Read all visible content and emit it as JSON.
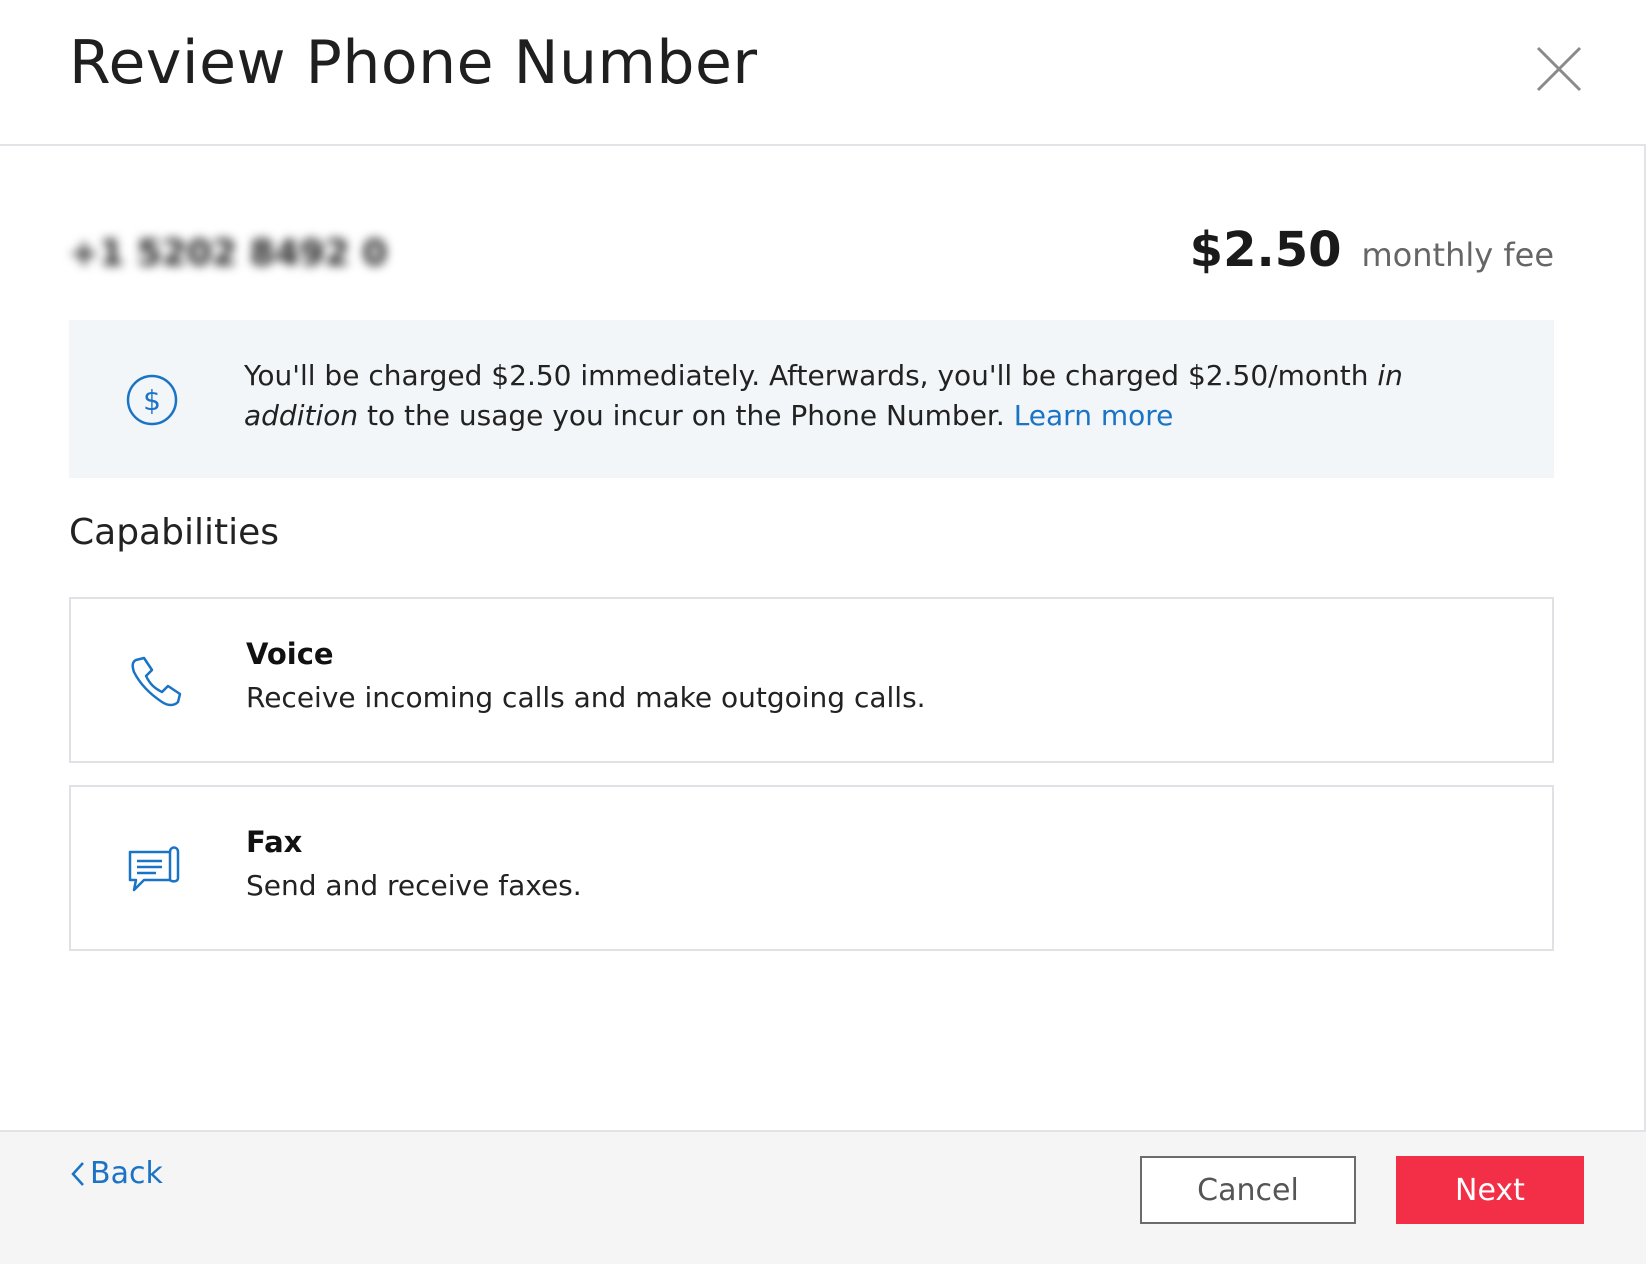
{
  "header": {
    "title": "Review Phone Number"
  },
  "number": {
    "phone": "+1 5202 8492 0",
    "fee_amount": "$2.50",
    "fee_label": "monthly fee"
  },
  "notice": {
    "text_part1": "You'll be charged $2.50 immediately. Afterwards, you'll be charged  $2.50/month ",
    "emphasis": "in addition",
    "text_part2": " to the usage you incur on the Phone Number. ",
    "link": "Learn more"
  },
  "capabilities": {
    "title": "Capabilities",
    "items": [
      {
        "name": "Voice",
        "description": "Receive incoming calls and make outgoing calls."
      },
      {
        "name": "Fax",
        "description": "Send and receive faxes."
      }
    ]
  },
  "footer": {
    "back_label": "Back",
    "cancel_label": "Cancel",
    "next_label": "Next"
  },
  "colors": {
    "accent_blue": "#1a73c5",
    "next_button": "#f22f46",
    "notice_bg": "#f2f6f9"
  },
  "icons": {
    "close": "close-icon",
    "dollar": "dollar-circle-icon",
    "voice": "phone-icon",
    "fax": "fax-icon",
    "back": "chevron-left-icon"
  }
}
